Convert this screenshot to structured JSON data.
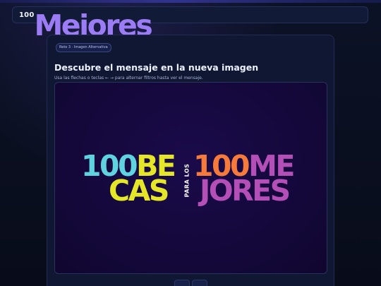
{
  "header": {
    "logo_number": "100",
    "logo_word": "Mejores"
  },
  "card": {
    "badge": "Reto 3 · Imagen Alternativa",
    "title": "Descubre el mensaje en la nueva imagen",
    "instructions": "Usa las flechas o teclas ← → para alternar filtros hasta ver el mensaje."
  },
  "image": {
    "line1_a": "100",
    "line1_b": "BE",
    "line2": "CAS",
    "vertical": "PARA LOS",
    "line3_a": "100",
    "line3_b": "ME",
    "line4": "JORES"
  },
  "colors": {
    "cyan": "#5fd3e0",
    "yellow": "#e6e629",
    "orange": "#f57a3c",
    "magenta": "#b44fb8",
    "accent": "#9b7cf5"
  },
  "icons": {
    "prev": "arrow-left-icon",
    "next": "arrow-right-icon"
  }
}
